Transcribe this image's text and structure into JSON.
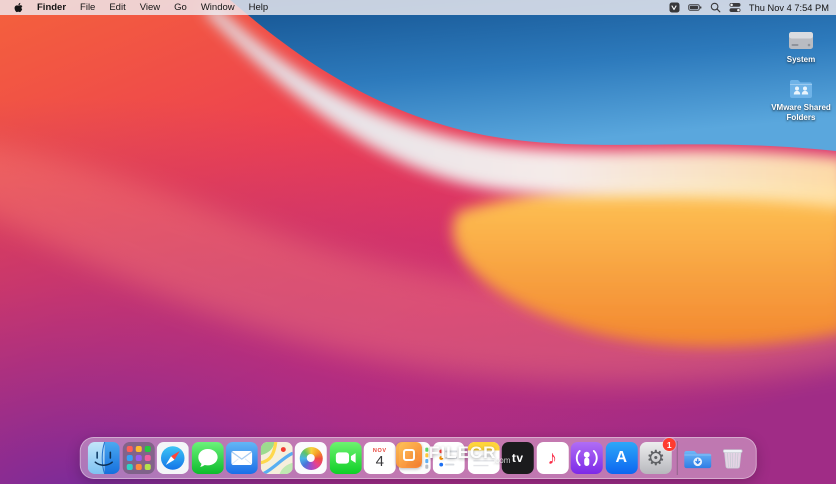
{
  "menu_bar": {
    "menus": [
      {
        "label": "Finder"
      },
      {
        "label": "File"
      },
      {
        "label": "Edit"
      },
      {
        "label": "View"
      },
      {
        "label": "Go"
      },
      {
        "label": "Window"
      },
      {
        "label": "Help"
      }
    ],
    "status_icons": [
      "vmware-tools-icon",
      "battery-icon",
      "spotlight-icon",
      "control-center-icon"
    ],
    "clock": "Thu Nov 4  7:54 PM"
  },
  "desktop": {
    "icons": [
      {
        "label": "System",
        "icon": "hard-drive-icon"
      },
      {
        "label": "VMware Shared Folders",
        "icon": "shared-folder-icon"
      }
    ]
  },
  "dock": {
    "items": [
      "Finder",
      "Launchpad",
      "Safari",
      "Messages",
      "Mail",
      "Maps",
      "Photos",
      "FaceTime",
      "Calendar",
      "Contacts",
      "Reminders",
      "Notes",
      "TV",
      "Music",
      "Podcasts",
      "App Store",
      "System Preferences",
      "Downloads",
      "Trash"
    ],
    "calendar_month": "NOV",
    "calendar_day": "4",
    "tv_label": "tv",
    "app_store_letter": "A",
    "system_preferences_badge": "1"
  },
  "watermark": {
    "title": "FILECR",
    "domain": ".com"
  },
  "colors": {
    "wallpaper_blue": "#2d7abc",
    "wallpaper_red": "#ed4150",
    "wallpaper_orange": "#f5a230",
    "wallpaper_purple": "#8e2f9c",
    "badge_red": "#ff3b30"
  }
}
